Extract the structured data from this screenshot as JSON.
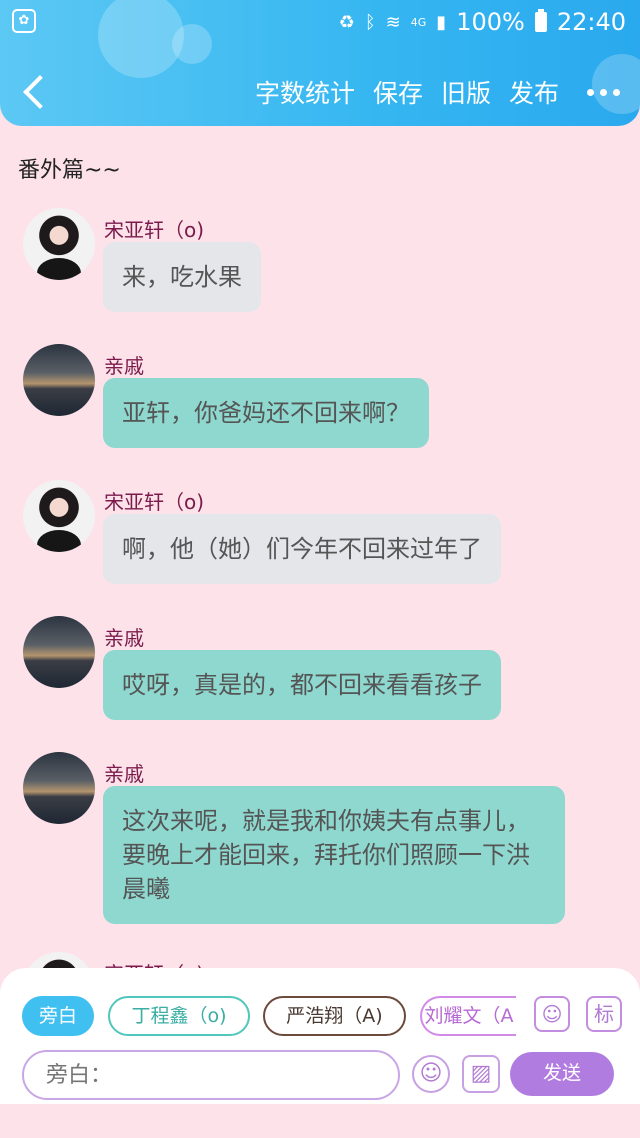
{
  "status_bar": {
    "battery": "100%",
    "time": "22:40",
    "network": "4G"
  },
  "header": {
    "back_icon": "chevron-left-icon",
    "actions": [
      "字数统计",
      "保存",
      "旧版",
      "发布"
    ],
    "more_icon": "more-horizontal-icon"
  },
  "chat": {
    "chapter_title": "番外篇~~",
    "messages": [
      {
        "sender": "宋亚轩（o)",
        "text": "来，吃水果",
        "style": "grey"
      },
      {
        "sender": "亲戚",
        "text": "亚轩，你爸妈还不回来啊？",
        "style": "teal"
      },
      {
        "sender": "宋亚轩（o)",
        "text": "啊，他（她）们今年不回来过年了",
        "style": "grey"
      },
      {
        "sender": "亲戚",
        "text": "哎呀，真是的，都不回来看看孩子",
        "style": "teal"
      },
      {
        "sender": "亲戚",
        "text": "这次来呢，就是我和你姨夫有点事儿，要晚上才能回来，拜托你们照顾一下洪晨曦",
        "style": "teal"
      },
      {
        "sender": "宋亚轩（o)",
        "text": "",
        "style": "grey"
      }
    ]
  },
  "role_chips": [
    "旁白",
    "丁程鑫（o)",
    "严浩翔（A)",
    "刘耀文（A"
  ],
  "tools": {
    "role_icon": "person-card-icon",
    "tag_label": "标"
  },
  "input": {
    "placeholder": "旁白：",
    "emoji_icon": "emoji-icon",
    "image_icon": "image-icon",
    "send_label": "发送"
  },
  "colors": {
    "header_blue": "#35b6f1",
    "background_pink": "#fde2ea",
    "bubble_grey": "#e4e6ea",
    "bubble_teal": "#8ed8cf",
    "sender_text": "#7a1b4b",
    "send_purple": "#b17ce0"
  }
}
